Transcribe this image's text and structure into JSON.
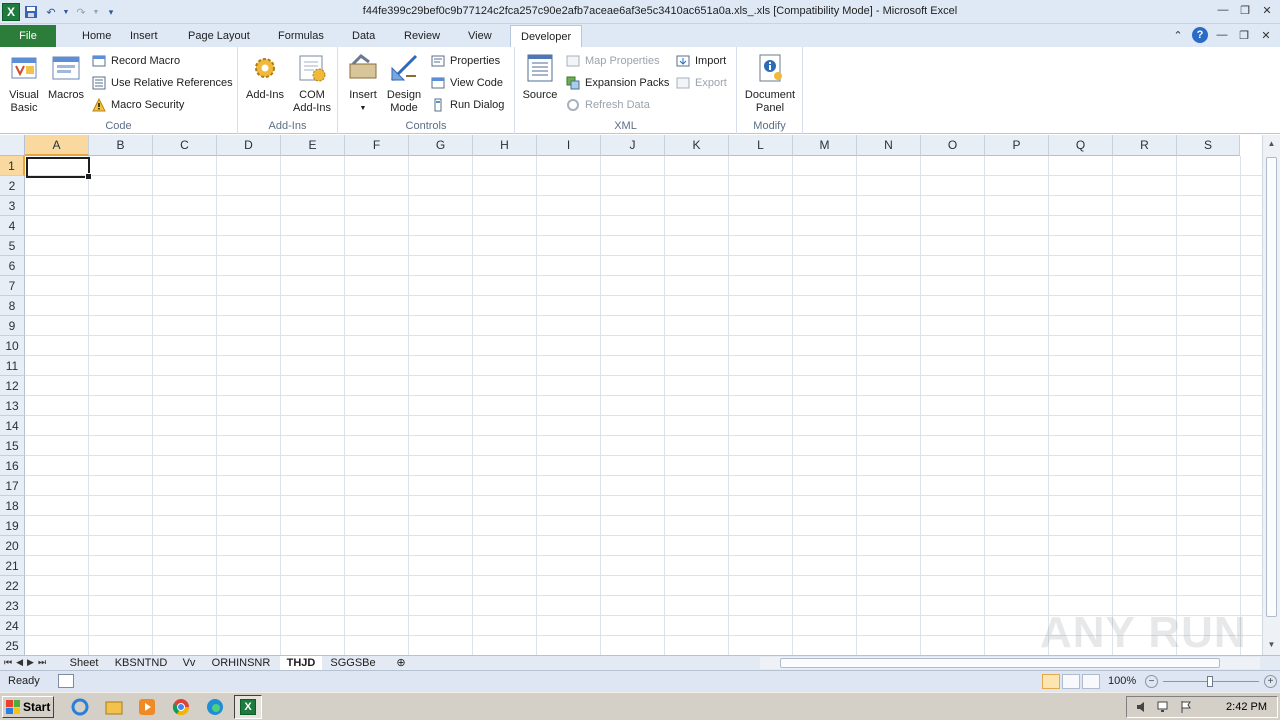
{
  "window": {
    "title": "f44fe399c29bef0c9b77124c2fca257c90e2afb7aceae6af3e5c3410ac651a0a.xls_.xls  [Compatibility Mode]  -  Microsoft Excel"
  },
  "tabs": [
    "File",
    "Home",
    "Insert",
    "Page Layout",
    "Formulas",
    "Data",
    "Review",
    "View",
    "Developer"
  ],
  "active_tab": "Developer",
  "ribbon": {
    "code": {
      "label": "Code",
      "visual_basic": "Visual Basic",
      "macros": "Macros",
      "record_macro": "Record Macro",
      "use_relative": "Use Relative References",
      "macro_security": "Macro Security"
    },
    "addins": {
      "label": "Add-Ins",
      "addins_btn": "Add-Ins",
      "com_addins": "COM Add-Ins"
    },
    "controls": {
      "label": "Controls",
      "insert": "Insert",
      "design_mode": "Design Mode",
      "properties": "Properties",
      "view_code": "View Code",
      "run_dialog": "Run Dialog"
    },
    "xml": {
      "label": "XML",
      "source": "Source",
      "map_properties": "Map Properties",
      "expansion_packs": "Expansion Packs",
      "refresh_data": "Refresh Data",
      "import": "Import",
      "export": "Export"
    },
    "modify": {
      "label": "Modify",
      "document_panel": "Document Panel"
    }
  },
  "grid": {
    "columns": [
      "A",
      "B",
      "C",
      "D",
      "E",
      "F",
      "G",
      "H",
      "I",
      "J",
      "K",
      "L",
      "M",
      "N",
      "O",
      "P",
      "Q",
      "R",
      "S"
    ],
    "rows": [
      "1",
      "2",
      "3",
      "4",
      "5",
      "6",
      "7",
      "8",
      "9",
      "10",
      "11",
      "12",
      "13",
      "14",
      "15",
      "16",
      "17",
      "18",
      "19",
      "20",
      "21",
      "22",
      "23",
      "24",
      "25"
    ],
    "active_cell": "A1"
  },
  "sheets": [
    "Sheet",
    "KBSNTND",
    "Vv",
    "ORHINSNR",
    "THJD",
    "SGGSBe"
  ],
  "active_sheet": "THJD",
  "status": {
    "text": "Ready",
    "zoom": "100%"
  },
  "taskbar": {
    "start": "Start",
    "clock": "2:42 PM"
  },
  "watermark": "ANY RUN"
}
